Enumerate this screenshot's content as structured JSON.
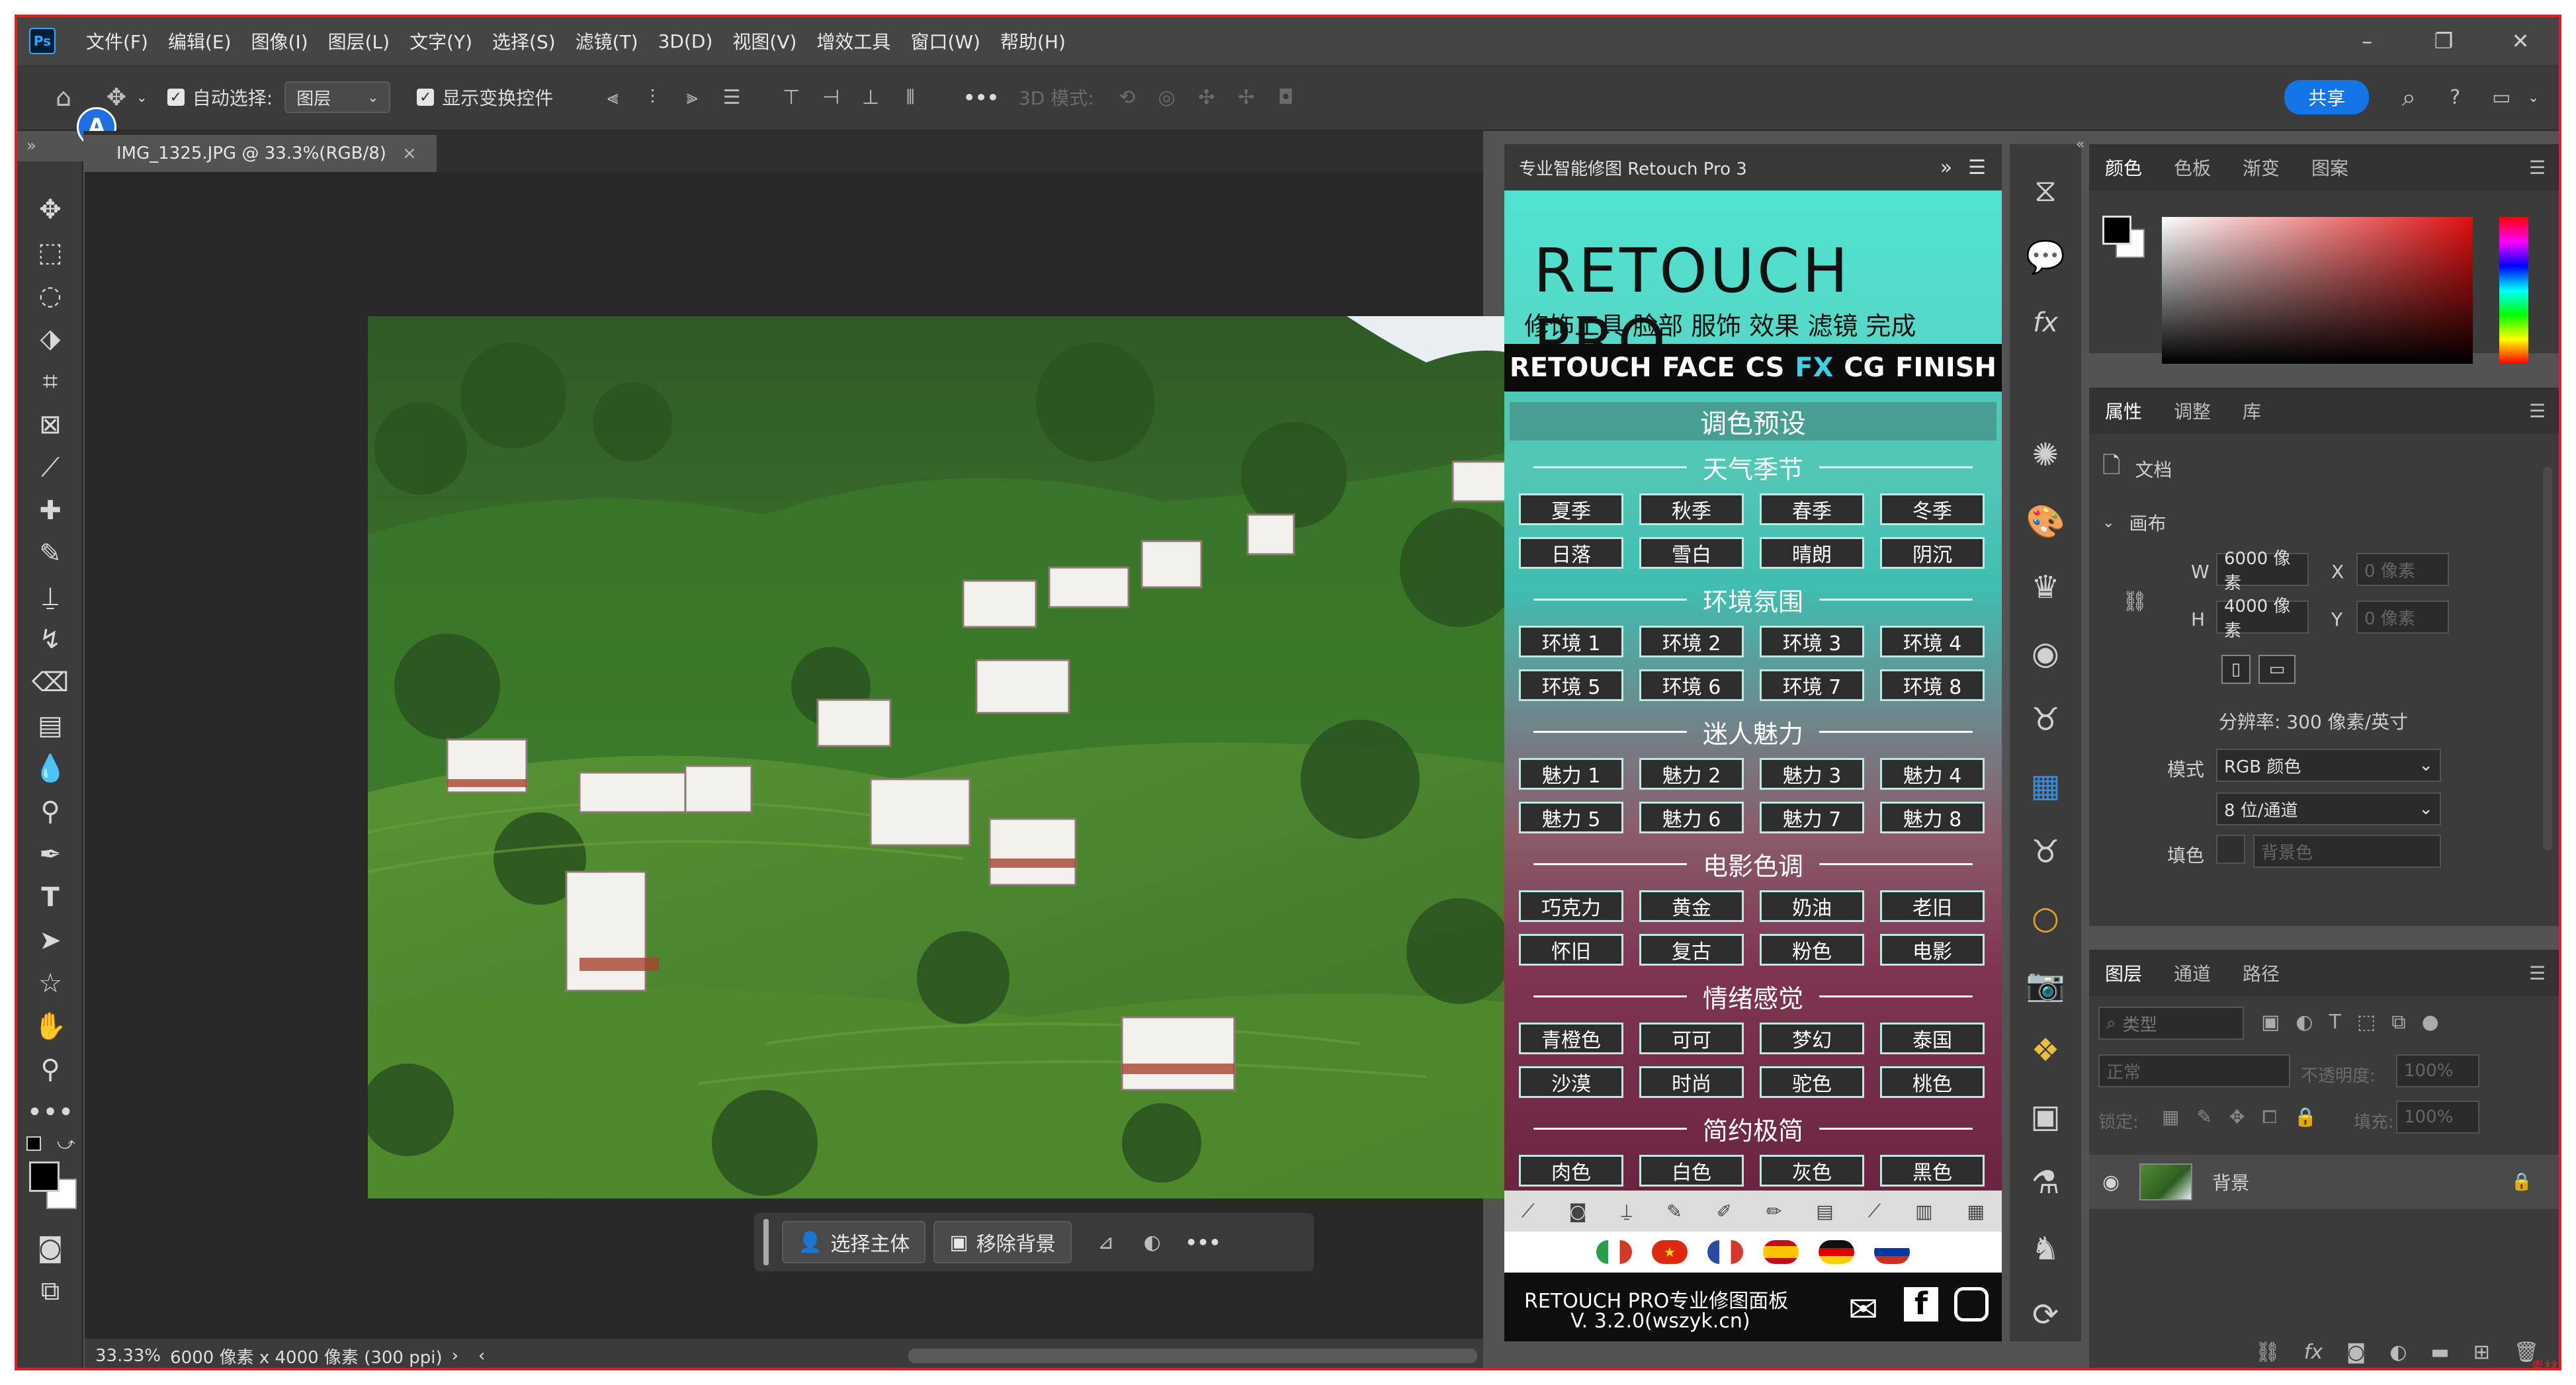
{
  "menu": {
    "app_icon": "Ps",
    "items": [
      "文件(F)",
      "编辑(E)",
      "图像(I)",
      "图层(L)",
      "文字(Y)",
      "选择(S)",
      "滤镜(T)",
      "3D(D)",
      "视图(V)",
      "增效工具",
      "窗口(W)",
      "帮助(H)"
    ],
    "window_buttons": [
      "–",
      "❐",
      "✕"
    ]
  },
  "options": {
    "auto_select_label": "自动选择:",
    "auto_select_target": "图层",
    "show_transform_label": "显示变换控件",
    "more": "•••",
    "mode3d_label": "3D 模式:",
    "share_label": "共享"
  },
  "document": {
    "tab_title": "IMG_1325.JPG @ 33.3%(RGB/8)",
    "tab_close": "×",
    "zoom": "33.33%",
    "info": "6000 像素 x 4000 像素 (300 ppi)",
    "info_arrow": "›",
    "scroll_left": "‹"
  },
  "context_bar": {
    "select_subject": "选择主体",
    "remove_background": "移除背景",
    "more": "•••"
  },
  "retouch": {
    "panel_title": "专业智能修图 Retouch Pro 3",
    "panel_expand": "»",
    "logo": "RETOUCH PRO",
    "subtitle": "修饰工具  脸部  服饰  效果  滤镜  完成",
    "tabs": [
      "RETOUCH",
      "FACE",
      "CS",
      "FX",
      "CG",
      "FINISH"
    ],
    "active_tab": "FX",
    "header": "调色预设",
    "sections": [
      {
        "title": "天气季节",
        "buttons": [
          "夏季",
          "秋季",
          "春季",
          "冬季",
          "日落",
          "雪白",
          "晴朗",
          "阴沉"
        ]
      },
      {
        "title": "环境氛围",
        "buttons": [
          "环境 1",
          "环境 2",
          "环境 3",
          "环境 4",
          "环境 5",
          "环境 6",
          "环境 7",
          "环境 8"
        ]
      },
      {
        "title": "迷人魅力",
        "buttons": [
          "魅力 1",
          "魅力 2",
          "魅力 3",
          "魅力 4",
          "魅力 5",
          "魅力 6",
          "魅力 7",
          "魅力 8"
        ]
      },
      {
        "title": "电影色调",
        "buttons": [
          "巧克力",
          "黄金",
          "奶油",
          "老旧",
          "怀旧",
          "复古",
          "粉色",
          "电影"
        ]
      },
      {
        "title": "情绪感觉",
        "buttons": [
          "青橙色",
          "可可",
          "梦幻",
          "泰国",
          "沙漠",
          "时尚",
          "驼色",
          "桃色"
        ]
      },
      {
        "title": "简约极简",
        "buttons": [
          "肉色",
          "白色",
          "灰色",
          "黑色"
        ]
      }
    ],
    "footer_line1": "RETOUCH PRO专业修图面板",
    "footer_line2": "V. 3.2.0(wszyk.cn)"
  },
  "color_panel": {
    "tabs": [
      "颜色",
      "色板",
      "渐变",
      "图案"
    ],
    "fg": "#000000",
    "bg": "#ffffff"
  },
  "properties": {
    "tabs": [
      "属性",
      "调整",
      "库"
    ],
    "doc_label": "文档",
    "canvas_label": "画布",
    "w_label": "W",
    "w_value": "6000 像素",
    "h_label": "H",
    "h_value": "4000 像素",
    "x_label": "X",
    "x_value": "0 像素",
    "y_label": "Y",
    "y_value": "0 像素",
    "resolution": "分辨率: 300 像素/英寸",
    "mode_label": "模式",
    "mode_value": "RGB 颜色",
    "depth_value": "8 位/通道",
    "fill_label": "填色",
    "fill_value": "背景色"
  },
  "layers": {
    "tabs": [
      "图层",
      "通道",
      "路径"
    ],
    "filter_placeholder": "类型",
    "blend_mode": "正常",
    "opacity_label": "不透明度:",
    "opacity_value": "100%",
    "lock_label": "锁定:",
    "fill_label": "填充:",
    "fill_value": "100%",
    "layer_name": "背景"
  },
  "watermark": "素材"
}
